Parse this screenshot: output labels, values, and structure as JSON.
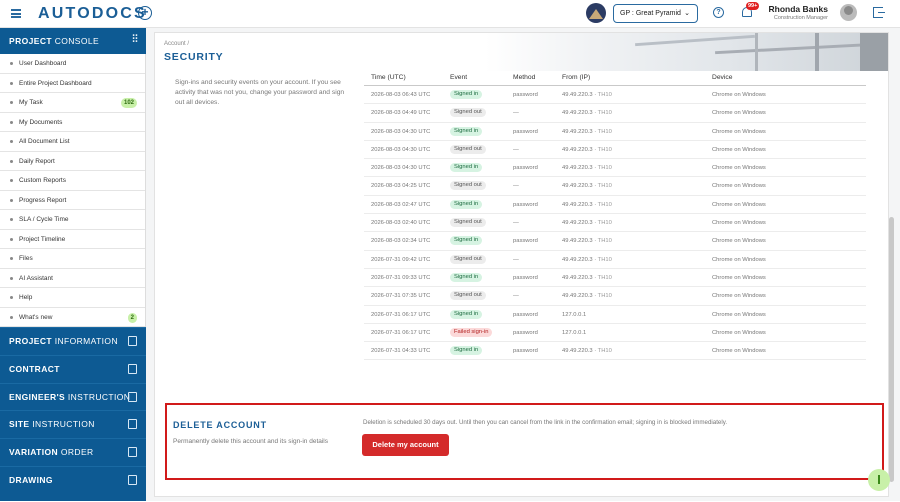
{
  "header": {
    "logo": "AUTODOCS",
    "project_selector": "GP : Great Pyramid",
    "notifications_badge": "99+",
    "user_name": "Rhonda Banks",
    "user_role": "Construction Manager"
  },
  "sidebar": {
    "project_console": {
      "strong": "PROJECT",
      "light": "CONSOLE"
    },
    "items": [
      {
        "label": "User Dashboard",
        "count": ""
      },
      {
        "label": "Entire Project Dashboard",
        "count": ""
      },
      {
        "label": "My Task",
        "count": "102"
      },
      {
        "label": "My Documents",
        "count": ""
      },
      {
        "label": "All Document List",
        "count": ""
      },
      {
        "label": "Daily Report",
        "count": ""
      },
      {
        "label": "Custom Reports",
        "count": ""
      },
      {
        "label": "Progress Report",
        "count": ""
      },
      {
        "label": "SLA / Cycle Time",
        "count": ""
      },
      {
        "label": "Project Timeline",
        "count": ""
      },
      {
        "label": "Files",
        "count": ""
      },
      {
        "label": "AI Assistant",
        "count": ""
      },
      {
        "label": "Help",
        "count": ""
      },
      {
        "label": "What's new",
        "count": "2"
      }
    ],
    "sections": [
      {
        "strong": "PROJECT",
        "light": "INFORMATION"
      },
      {
        "strong": "CONTRACT",
        "light": ""
      },
      {
        "strong": "ENGINEER'S",
        "light": "INSTRUCTION"
      },
      {
        "strong": "SITE",
        "light": "INSTRUCTION"
      },
      {
        "strong": "VARIATION",
        "light": "ORDER"
      },
      {
        "strong": "DRAWING",
        "light": ""
      }
    ]
  },
  "page": {
    "breadcrumb": "Account",
    "title": "SECURITY",
    "description": "Sign-ins and security events on your account. If you see activity that was not you, change your password and sign out all devices."
  },
  "table": {
    "headers": [
      "Time (UTC)",
      "Event",
      "Method",
      "From (IP)",
      "Device"
    ],
    "rows": [
      {
        "time": "2026-08-03 06:43 UTC",
        "event": "Signed in",
        "type": "in",
        "method": "password",
        "ip": "49.49.220.3",
        "loc": "TH10",
        "device": "Chrome on Windows"
      },
      {
        "time": "2026-08-03 04:49 UTC",
        "event": "Signed out",
        "type": "out",
        "method": "—",
        "ip": "49.49.220.3",
        "loc": "TH10",
        "device": "Chrome on Windows"
      },
      {
        "time": "2026-08-03 04:30 UTC",
        "event": "Signed in",
        "type": "in",
        "method": "password",
        "ip": "49.49.220.3",
        "loc": "TH10",
        "device": "Chrome on Windows"
      },
      {
        "time": "2026-08-03 04:30 UTC",
        "event": "Signed out",
        "type": "out",
        "method": "—",
        "ip": "49.49.220.3",
        "loc": "TH10",
        "device": "Chrome on Windows"
      },
      {
        "time": "2026-08-03 04:30 UTC",
        "event": "Signed in",
        "type": "in",
        "method": "password",
        "ip": "49.49.220.3",
        "loc": "TH10",
        "device": "Chrome on Windows"
      },
      {
        "time": "2026-08-03 04:25 UTC",
        "event": "Signed out",
        "type": "out",
        "method": "—",
        "ip": "49.49.220.3",
        "loc": "TH10",
        "device": "Chrome on Windows"
      },
      {
        "time": "2026-08-03 02:47 UTC",
        "event": "Signed in",
        "type": "in",
        "method": "password",
        "ip": "49.49.220.3",
        "loc": "TH10",
        "device": "Chrome on Windows"
      },
      {
        "time": "2026-08-03 02:40 UTC",
        "event": "Signed out",
        "type": "out",
        "method": "—",
        "ip": "49.49.220.3",
        "loc": "TH10",
        "device": "Chrome on Windows"
      },
      {
        "time": "2026-08-03 02:34 UTC",
        "event": "Signed in",
        "type": "in",
        "method": "password",
        "ip": "49.49.220.3",
        "loc": "TH10",
        "device": "Chrome on Windows"
      },
      {
        "time": "2026-07-31 09:42 UTC",
        "event": "Signed out",
        "type": "out",
        "method": "—",
        "ip": "49.49.220.3",
        "loc": "TH10",
        "device": "Chrome on Windows"
      },
      {
        "time": "2026-07-31 09:33 UTC",
        "event": "Signed in",
        "type": "in",
        "method": "password",
        "ip": "49.49.220.3",
        "loc": "TH10",
        "device": "Chrome on Windows"
      },
      {
        "time": "2026-07-31 07:35 UTC",
        "event": "Signed out",
        "type": "out",
        "method": "—",
        "ip": "49.49.220.3",
        "loc": "TH10",
        "device": "Chrome on Windows"
      },
      {
        "time": "2026-07-31 06:17 UTC",
        "event": "Signed in",
        "type": "in",
        "method": "password",
        "ip": "127.0.0.1",
        "loc": "",
        "device": "Chrome on Windows"
      },
      {
        "time": "2026-07-31 06:17 UTC",
        "event": "Failed sign-in",
        "type": "fail",
        "method": "password",
        "ip": "127.0.0.1",
        "loc": "",
        "device": "Chrome on Windows"
      },
      {
        "time": "2026-07-31 04:33 UTC",
        "event": "Signed in",
        "type": "in",
        "method": "password",
        "ip": "49.49.220.3",
        "loc": "TH10",
        "device": "Chrome on Windows"
      }
    ]
  },
  "delete_account": {
    "title": "DELETE ACCOUNT",
    "description": "Permanently delete this account and its sign-in details",
    "note": "Deletion is scheduled 30 days out. Until then you can cancel from the link in the confirmation email; signing in is blocked immediately.",
    "button": "Delete my account"
  },
  "colors": {
    "brand": "#0d5a93",
    "danger": "#d42a2a",
    "badge": "#c8f0a8"
  }
}
